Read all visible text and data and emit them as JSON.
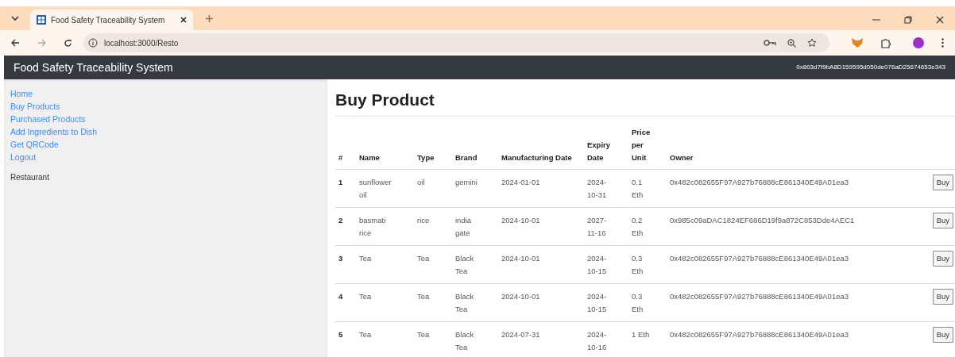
{
  "browser": {
    "tab_title": "Food Safety Traceability System",
    "url": "localhost:3000/Resto"
  },
  "navbar": {
    "brand": "Food Safety Traceability System",
    "account": "0x803d7f9bA8D159595d050de076aD25674653e343"
  },
  "sidebar": {
    "links": [
      "Home",
      "Buy Products",
      "Purchased Products",
      "Add Ingredients to Dish",
      "Get QRCode",
      "Logout"
    ],
    "role": "Restaurant"
  },
  "main": {
    "heading": "Buy Product",
    "table": {
      "columns": [
        "#",
        "Name",
        "Type",
        "Brand",
        "Manufacturing Date",
        "Expiry Date",
        "Price per Unit",
        "Owner"
      ],
      "rows": [
        {
          "cells": [
            "1",
            "sunflower oil",
            "oil",
            "gemini",
            "2024-01-01",
            "2024-10-31",
            "0.1 Eth",
            "0x482c082655F97A927b76888cE861340E49A01ea3"
          ],
          "action": "Buy"
        },
        {
          "cells": [
            "2",
            "basmati rice",
            "rice",
            "india gate",
            "2024-10-01",
            "2027-11-16",
            "0.2 Eth",
            "0x985c09aDAC1824EF686D19f9a872C853Dde4AEC1"
          ],
          "action": "Buy"
        },
        {
          "cells": [
            "3",
            "Tea",
            "Tea",
            "Black Tea",
            "2024-10-01",
            "2024-10-15",
            "0.3 Eth",
            "0x482c082655F97A927b76888cE861340E49A01ea3"
          ],
          "action": "Buy"
        },
        {
          "cells": [
            "4",
            "Tea",
            "Tea",
            "Black Tea",
            "2024-10-01",
            "2024-10-15",
            "0.3 Eth",
            "0x482c082655F97A927b76888cE861340E49A01ea3"
          ],
          "action": "Buy"
        },
        {
          "cells": [
            "5",
            "Tea",
            "Tea",
            "Black Tea",
            "2024-07-31",
            "2024-10-16",
            "1 Eth",
            "0x482c082655F97A927b76888cE861340E49A01ea3"
          ],
          "action": "Buy"
        }
      ]
    }
  }
}
